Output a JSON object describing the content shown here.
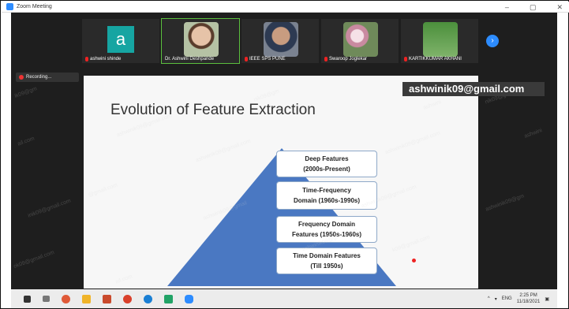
{
  "window": {
    "title": "Zoom Meeting",
    "minimize": "–",
    "maximize": "▢",
    "close": "✕"
  },
  "participants": [
    {
      "name": "ashwini shinde",
      "initial": "a"
    },
    {
      "name": "Dr. Ashwini Deshpande"
    },
    {
      "name": "IEEE SPS PUNE"
    },
    {
      "name": "Swaroop Joglekar"
    },
    {
      "name": "KARTIKKUMAR AKHANI"
    }
  ],
  "next_arrow": "›",
  "recording_label": "Recording...",
  "watermark_email": "ashwinik09@gmail.com",
  "watermark_fragment_1": "ik09@gm",
  "watermark_fragment_2": "ail.com",
  "watermark_fragment_3": "inik09@gmail.com",
  "watermark_fragment_4": "ashwini",
  "watermark_fragment_5": "ashwinik09@gm",
  "watermark_fragment_6": "nik09@gm",
  "watermark_fragment_7": "ok09@gmail.com",
  "watermark_fragment_8": "ashwinik09@gmail",
  "watermark_fragment_9": "@gmail.com",
  "watermark_fragment_10": "k09@gmail.com",
  "slide": {
    "title": "Evolution of Feature Extraction",
    "levels": [
      {
        "line1": "Deep Features",
        "line2": "(2000s-Present)"
      },
      {
        "line1": "Time-Frequency",
        "line2": "Domain (1960s-1990s)"
      },
      {
        "line1": "Frequency Domain",
        "line2": "Features (1950s-1960s)"
      },
      {
        "line1": "Time Domain Features",
        "line2": "(Till 1950s)"
      }
    ],
    "pyramid_color": "#4a78c2"
  },
  "taskbar": {
    "icons": [
      "windows-icon",
      "task-view-icon",
      "chrome-icon",
      "file-explorer-icon",
      "powerpoint-icon",
      "chrome-icon-2",
      "edge-icon",
      "excel-icon",
      "zoom-icon"
    ],
    "tray_lang": "ENG",
    "time": "2:25 PM",
    "date": "11/18/2021"
  }
}
